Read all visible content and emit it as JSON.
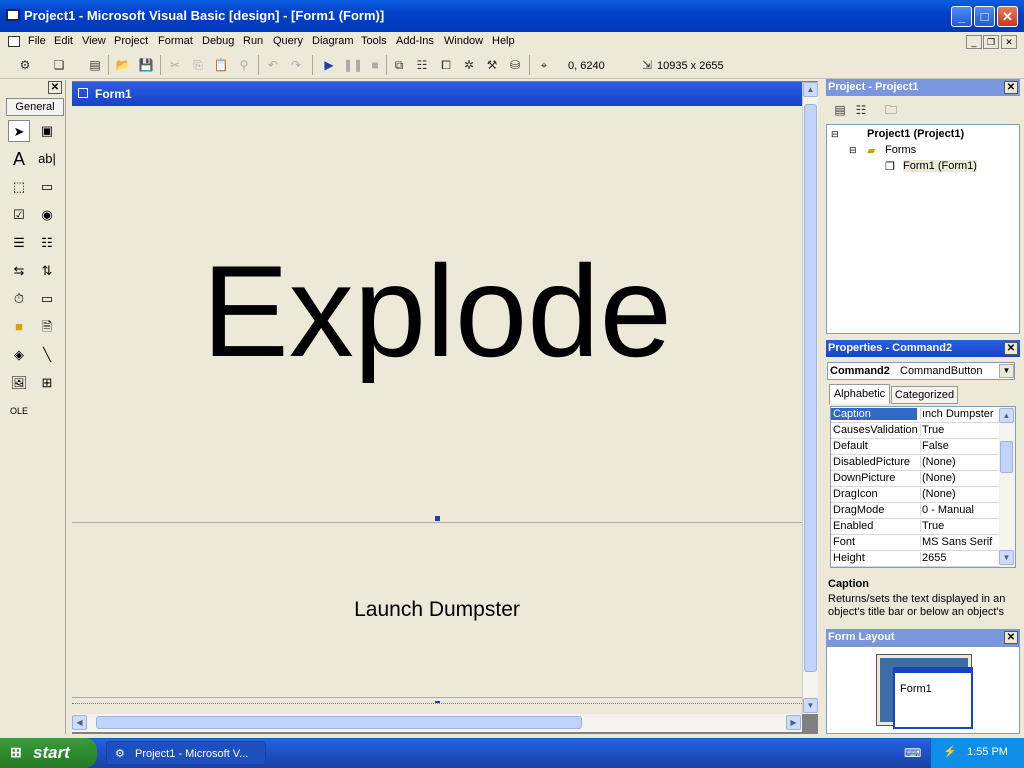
{
  "window": {
    "title": "Project1 - Microsoft Visual Basic [design] - [Form1 (Form)]"
  },
  "menus": [
    "File",
    "Edit",
    "View",
    "Project",
    "Format",
    "Debug",
    "Run",
    "Query",
    "Diagram",
    "Tools",
    "Add-Ins",
    "Window",
    "Help"
  ],
  "toolbar": {
    "position": "0, 6240",
    "size": "10935 x 2655"
  },
  "toolbox": {
    "tab_label": "General"
  },
  "form": {
    "title": "Form1",
    "label_text": "Explode",
    "button_caption": "Launch Dumpster"
  },
  "project_pane": {
    "title": "Project - Project1",
    "root": "Project1 (Project1)",
    "folder": "Forms",
    "item": "Form1 (Form1)"
  },
  "properties_pane": {
    "title": "Properties - Command2",
    "object_name": "Command2",
    "object_type": "CommandButton",
    "tabs": [
      "Alphabetic",
      "Categorized"
    ],
    "rows": [
      {
        "name": "Caption",
        "value": "ınch Dumpster"
      },
      {
        "name": "CausesValidation",
        "value": "True"
      },
      {
        "name": "Default",
        "value": "False"
      },
      {
        "name": "DisabledPicture",
        "value": "(None)"
      },
      {
        "name": "DownPicture",
        "value": "(None)"
      },
      {
        "name": "DragIcon",
        "value": "(None)"
      },
      {
        "name": "DragMode",
        "value": "0 - Manual"
      },
      {
        "name": "Enabled",
        "value": "True"
      },
      {
        "name": "Font",
        "value": "MS Sans Serif"
      },
      {
        "name": "Height",
        "value": "2655"
      }
    ],
    "desc_title": "Caption",
    "desc_text": "Returns/sets the text displayed in an object's title bar or below an object's"
  },
  "layout_pane": {
    "title": "Form Layout",
    "form_label": "Form1"
  },
  "taskbar": {
    "start": "start",
    "task": "Project1 - Microsoft V...",
    "clock": "1:55 PM"
  }
}
